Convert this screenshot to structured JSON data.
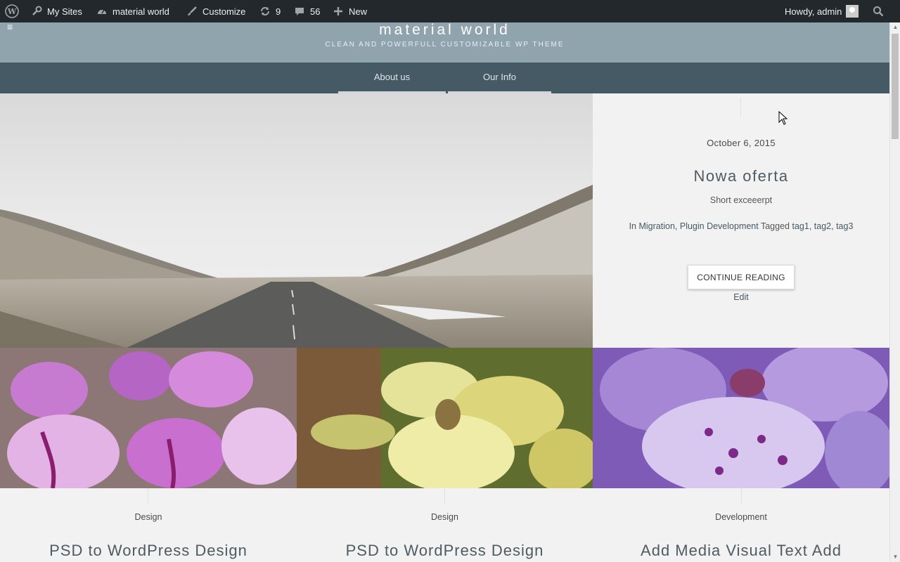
{
  "adminbar": {
    "my_sites": "My Sites",
    "site_name": "material world",
    "customize": "Customize",
    "updates_count": "9",
    "comments_count": "56",
    "new_label": "New",
    "greeting": "Howdy, admin"
  },
  "header": {
    "site_title": "material world",
    "tagline": "CLEAN AND POWERFULL CUSTOMIZABLE WP THEME"
  },
  "nav": {
    "items": [
      "About us",
      "Our Info"
    ]
  },
  "featured": {
    "date": "October 6, 2015",
    "title": "Nowa oferta",
    "excerpt": "Short exceeerpt",
    "in_label": "In",
    "cat1": "Migration",
    "cat2": "Plugin Development",
    "tagged_label": "Tagged",
    "tag1": "tag1",
    "tag2": "tag2",
    "tag3": "tag3",
    "continue_label": "CONTINUE READING",
    "edit_label": "Edit"
  },
  "cards": [
    {
      "category": "Design",
      "title": "PSD to WordPress Design"
    },
    {
      "category": "Design",
      "title": "PSD to WordPress Design"
    },
    {
      "category": "Development",
      "title": "Add Media Visual Text Add"
    }
  ],
  "colors": {
    "adminbar_bg": "#23282d",
    "header_bg": "#90a4ae",
    "nav_bg": "#455a64",
    "panel_bg": "#f2f2f2"
  }
}
